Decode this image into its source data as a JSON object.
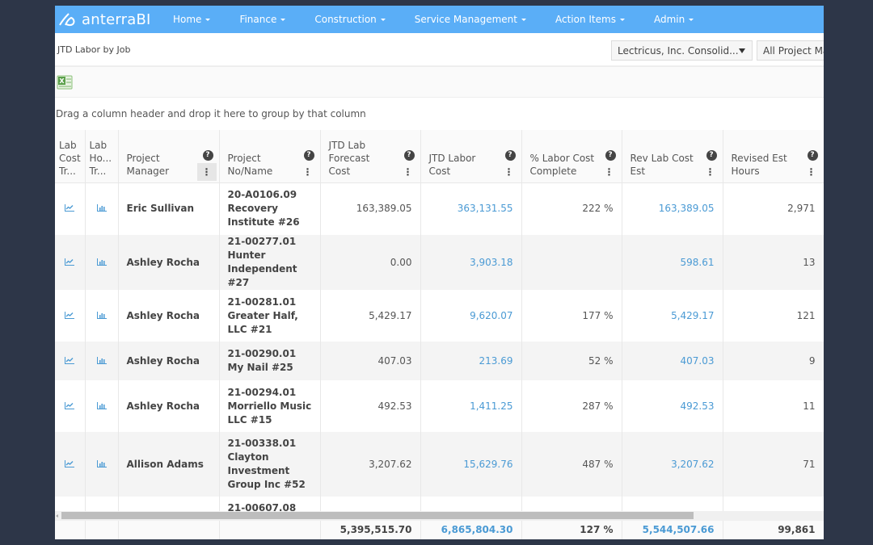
{
  "brand": {
    "name": "anterraBI",
    "color": "#5aaef7"
  },
  "nav": [
    {
      "label": "Home"
    },
    {
      "label": "Finance"
    },
    {
      "label": "Construction"
    },
    {
      "label": "Service Management"
    },
    {
      "label": "Action Items"
    },
    {
      "label": "Admin"
    }
  ],
  "page": {
    "title": "JTD Labor by Job",
    "company_select": "Lectricus, Inc. Consolid...",
    "manager_select": "All Project Ma"
  },
  "toolbar": {
    "export_icon": "excel-icon"
  },
  "group_panel": {
    "text": "Drag a column header and drop it here to group by that column"
  },
  "columns": [
    {
      "label": "Lab Cost Tr...",
      "key": "lab_cost_trend"
    },
    {
      "label": "Lab Ho... Tr...",
      "key": "lab_hours_trend"
    },
    {
      "label": "Project Manager",
      "key": "project_manager",
      "help": "?",
      "menu": "⋮"
    },
    {
      "label": "Project No/Name",
      "key": "project",
      "help": "?",
      "menu": "⋮"
    },
    {
      "label": "JTD Lab Forecast Cost",
      "key": "forecast_cost",
      "help": "?",
      "menu": "⋮"
    },
    {
      "label": "JTD Labor Cost",
      "key": "labor_cost",
      "help": "?",
      "menu": "⋮"
    },
    {
      "label": "% Labor Cost Complete",
      "key": "pct_complete",
      "help": "?",
      "menu": "⋮"
    },
    {
      "label": "Rev Lab Cost Est",
      "key": "rev_cost_est",
      "help": "?",
      "menu": "⋮"
    },
    {
      "label": "Revised Est Hours",
      "key": "rev_est_hours",
      "help": "?",
      "menu": "⋮"
    }
  ],
  "rows": [
    {
      "project_manager": "Eric Sullivan",
      "project": "20-A0106.09 Recovery Institute #26",
      "forecast_cost": "163,389.05",
      "labor_cost": "363,131.55",
      "pct_complete": "222 %",
      "rev_cost_est": "163,389.05",
      "rev_est_hours": "2,971"
    },
    {
      "project_manager": "Ashley Rocha",
      "project": "21-00277.01 Hunter Independent #27",
      "forecast_cost": "0.00",
      "labor_cost": "3,903.18",
      "pct_complete": "",
      "rev_cost_est": "598.61",
      "rev_est_hours": "13"
    },
    {
      "project_manager": "Ashley Rocha",
      "project": "21-00281.01 Greater Half, LLC #21",
      "forecast_cost": "5,429.17",
      "labor_cost": "9,620.07",
      "pct_complete": "177 %",
      "rev_cost_est": "5,429.17",
      "rev_est_hours": "121"
    },
    {
      "project_manager": "Ashley Rocha",
      "project": "21-00290.01 My Nail #25",
      "forecast_cost": "407.03",
      "labor_cost": "213.69",
      "pct_complete": "52 %",
      "rev_cost_est": "407.03",
      "rev_est_hours": "9"
    },
    {
      "project_manager": "Ashley Rocha",
      "project": "21-00294.01 Morriello Music LLC #15",
      "forecast_cost": "492.53",
      "labor_cost": "1,411.25",
      "pct_complete": "287 %",
      "rev_cost_est": "492.53",
      "rev_est_hours": "11"
    },
    {
      "project_manager": "Allison Adams",
      "project": "21-00338.01 Clayton Investment Group Inc #52",
      "forecast_cost": "3,207.62",
      "labor_cost": "15,629.76",
      "pct_complete": "487 %",
      "rev_cost_est": "3,207.62",
      "rev_est_hours": "71"
    },
    {
      "project_manager": "",
      "project": "21-00607.08",
      "forecast_cost": "",
      "labor_cost": "",
      "pct_complete": "",
      "rev_cost_est": "",
      "rev_est_hours": ""
    }
  ],
  "totals": {
    "forecast_cost": "5,395,515.70",
    "labor_cost": "6,865,804.30",
    "pct_complete": "127 %",
    "rev_cost_est": "5,544,507.66",
    "rev_est_hours": "99,861"
  },
  "colors": {
    "link": "#4a9ad4",
    "background": "#2d3648"
  }
}
